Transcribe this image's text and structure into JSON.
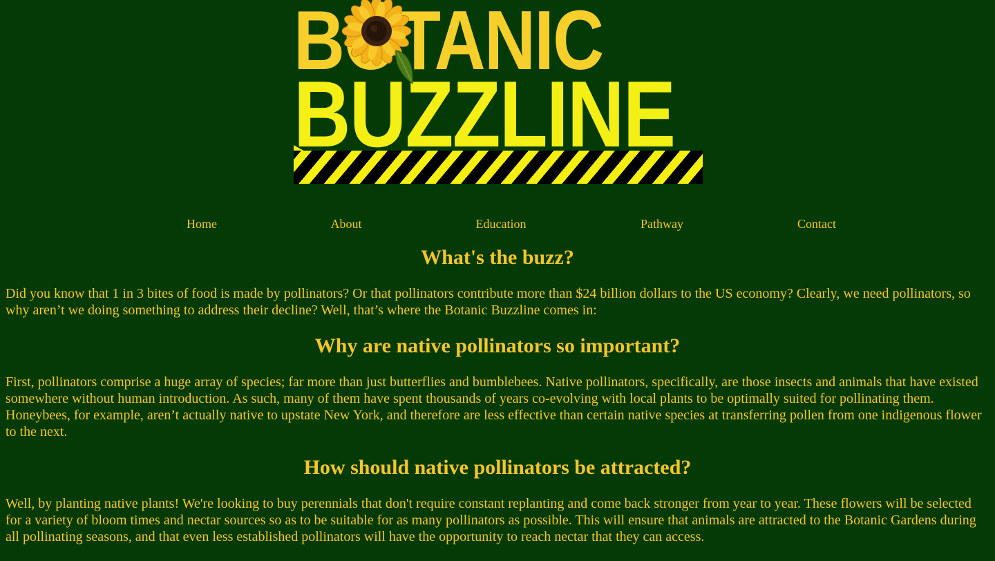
{
  "logo": {
    "line1": "BOTANIC",
    "line2": "BUZZLINE",
    "icon": "sunflower-icon"
  },
  "nav": {
    "items": [
      {
        "label": "Home"
      },
      {
        "label": "About"
      },
      {
        "label": "Education"
      },
      {
        "label": "Pathway"
      },
      {
        "label": "Contact"
      }
    ]
  },
  "sections": [
    {
      "heading": "What's the buzz?",
      "body": "Did you know that 1 in 3 bites of food is made by pollinators? Or that pollinators contribute more than $24 billion dollars to the US economy? Clearly, we need pollinators, so why aren’t we doing something to address their decline? Well, that’s where the Botanic Buzzline comes in:"
    },
    {
      "heading": "Why are native pollinators so important?",
      "body": "First, pollinators comprise a huge array of species; far more than just butterflies and bumblebees. Native pollinators, specifically, are those insects and animals that have existed somewhere without human introduction. As such, many of them have spent thousands of years co-evolving with local plants to be optimally suited for pollinating them. Honeybees, for example, aren’t actually native to upstate New York, and therefore are less effective than certain native species at transferring pollen from one indigenous flower to the next."
    },
    {
      "heading": "How should native pollinators be attracted?",
      "body": "Well, by planting native plants! We're looking to buy perennials that don't require constant replanting and come back stronger from year to year. These flowers will be selected for a variety of bloom times and nectar sources so as to be suitable for as many pollinators as possible. This will ensure that animals are attracted to the Botanic Gardens during all pollinating seasons, and that even less established pollinators will have the opportunity to reach nectar that they can access."
    }
  ],
  "colors": {
    "background": "#033a06",
    "text": "#f6c52a",
    "logo_top": "#f7cf2a",
    "logo_bottom": "#f4ef14",
    "stripe_dark": "#000000"
  }
}
